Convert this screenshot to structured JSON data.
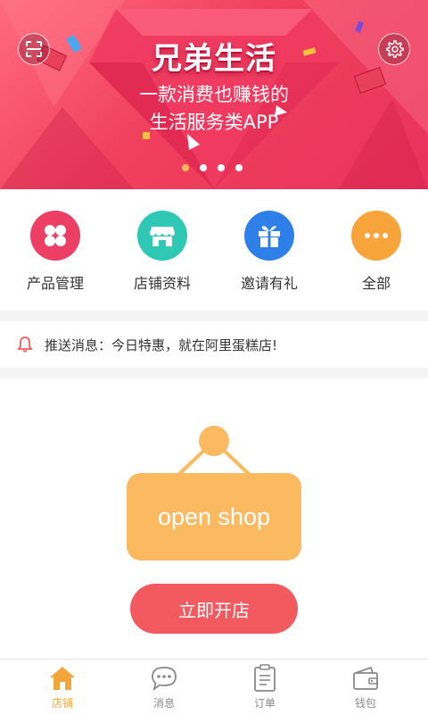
{
  "banner": {
    "title": "兄弟生活",
    "line1": "一款消费也赚钱的",
    "line2": "生活服务类APP",
    "slide_count": 4,
    "active_slide": 1
  },
  "quick_menu": {
    "items": [
      {
        "label": "产品管理",
        "icon": "clover-icon",
        "color": "#ec3f63"
      },
      {
        "label": "店铺资料",
        "icon": "store-icon",
        "color": "#2ec8b4"
      },
      {
        "label": "邀请有礼",
        "icon": "gift-icon",
        "color": "#2f7fe8"
      },
      {
        "label": "全部",
        "icon": "more-icon",
        "color": "#f7a43a"
      }
    ]
  },
  "notice": {
    "text": "推送消息：今日特惠，就在阿里蛋糕店!",
    "icon": "bell-icon"
  },
  "open_shop": {
    "sign_text": "open shop",
    "button_label": "立即开店",
    "sign_color": "#fbb960",
    "button_color": "#f35a5f"
  },
  "tabbar": {
    "items": [
      {
        "label": "店铺",
        "icon": "home-icon",
        "active": true
      },
      {
        "label": "消息",
        "icon": "chat-icon",
        "active": false
      },
      {
        "label": "订单",
        "icon": "order-icon",
        "active": false
      },
      {
        "label": "钱包",
        "icon": "wallet-icon",
        "active": false
      }
    ],
    "active_color": "#f3a53a"
  }
}
